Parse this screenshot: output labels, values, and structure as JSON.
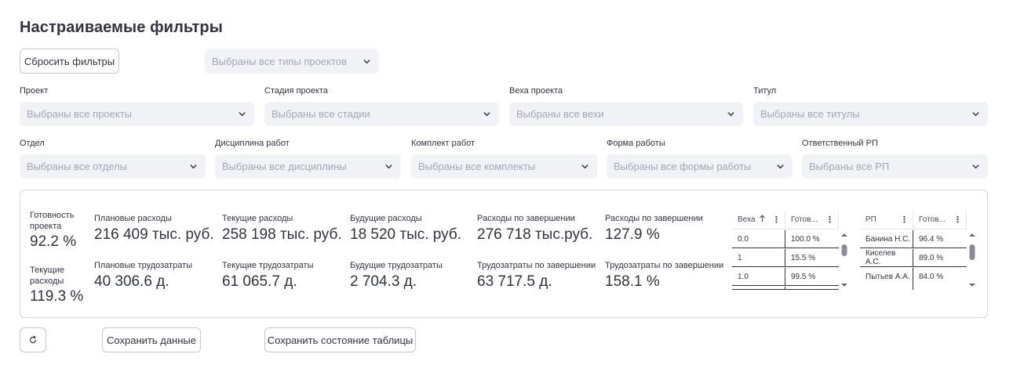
{
  "page": {
    "title": "Настраиваемые фильтры"
  },
  "top": {
    "reset_label": "Сбросить фильтры",
    "project_types_placeholder": "Выбраны все типы проектов"
  },
  "filters_row1": [
    {
      "label": "Проект",
      "placeholder": "Выбраны все проекты"
    },
    {
      "label": "Стадия проекта",
      "placeholder": "Выбраны все стадии"
    },
    {
      "label": "Веха проекта",
      "placeholder": "Выбраны все вехи"
    },
    {
      "label": "Титул",
      "placeholder": "Выбраны все титулы"
    }
  ],
  "filters_row2": [
    {
      "label": "Отдел",
      "placeholder": "Выбраны все отделы"
    },
    {
      "label": "Дисциплина работ",
      "placeholder": "Выбраны все дисциплины"
    },
    {
      "label": "Комплект работ",
      "placeholder": "Выбраны все комплекты"
    },
    {
      "label": "Форма работы",
      "placeholder": "Выбраны все формы работы"
    },
    {
      "label": "Ответственный РП",
      "placeholder": "Выбраны все РП"
    }
  ],
  "metrics": {
    "readiness": {
      "label": "Готовность проекта",
      "value": "92.2 %"
    },
    "current_exp_ratio": {
      "label": "Текущие расходы",
      "value": "119.3 %"
    },
    "planned_exp": {
      "label": "Плановые расходы",
      "value": "216 409 тыс. руб."
    },
    "current_exp": {
      "label": "Текущие расходы",
      "value": "258 198 тыс. руб."
    },
    "future_exp": {
      "label": "Будущие расходы",
      "value": "18 520 тыс. руб."
    },
    "exp_completion": {
      "label": "Расходы по завершении",
      "value": "276 718 тыс.руб."
    },
    "exp_completion_pct": {
      "label": "Расходы по завершении",
      "value": "127.9 %"
    },
    "planned_labor": {
      "label": "Плановые трудозатраты",
      "value": "40 306.6 д."
    },
    "current_labor": {
      "label": "Текущие трудозатраты",
      "value": "61 065.7 д."
    },
    "future_labor": {
      "label": "Будущие трудозатраты",
      "value": "2 704.3 д."
    },
    "labor_completion": {
      "label": "Трудозатраты по завершении",
      "value": "63 717.5 д."
    },
    "labor_completion_pct": {
      "label": "Трудозатраты по завершении",
      "value": "158.1 %"
    }
  },
  "milestone_table": {
    "columns": [
      "Веха",
      "Готов..."
    ],
    "sort_icon": "arrow-up-icon",
    "rows": [
      [
        "0.0",
        "100.0 %"
      ],
      [
        "1",
        "15.5 %"
      ],
      [
        "1.0",
        "99.5 %"
      ]
    ]
  },
  "pm_table": {
    "columns": [
      "РП",
      "Готов..."
    ],
    "rows": [
      [
        "Банина Н.С.",
        "96.4 %"
      ],
      [
        "Киселев А.С.",
        "89.0 %"
      ],
      [
        "Пытьев А.А.",
        "84.0 %"
      ]
    ]
  },
  "bottom": {
    "refresh_icon": "refresh-icon",
    "save_data_label": "Сохранить данные",
    "save_table_label": "Сохранить состояние таблицы"
  }
}
